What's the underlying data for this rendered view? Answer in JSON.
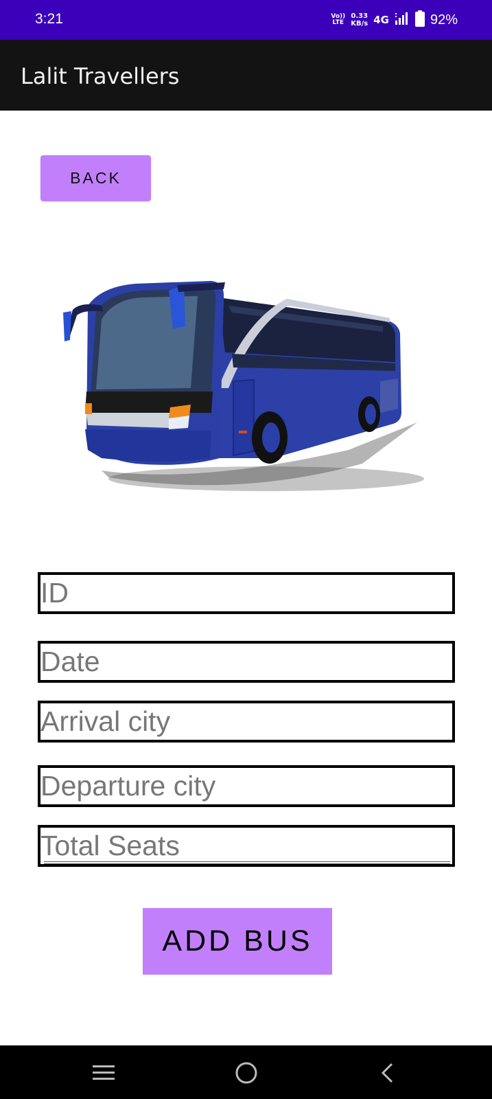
{
  "status_bar": {
    "time": "3:21",
    "volte_top": "Vo))",
    "volte_bottom": "LTE",
    "net_speed_value": "0.33",
    "net_speed_unit": "KB/s",
    "network_type": "4G",
    "battery_percent": "92%"
  },
  "app_bar": {
    "title": "Lalit Travellers"
  },
  "back_button": {
    "label": "BACK"
  },
  "form": {
    "id_placeholder": "ID",
    "date_placeholder": "Date",
    "arrival_city_placeholder": "Arrival city",
    "departure_city_placeholder": "Departure city",
    "total_seats_placeholder": "Total Seats"
  },
  "add_bus_button": {
    "label": "ADD BUS"
  },
  "icons": {
    "nav_recents": "menu-icon",
    "nav_home": "circle-home-icon",
    "nav_back": "chevron-left-icon",
    "battery": "battery-icon",
    "signal": "signal-icon"
  },
  "colors": {
    "status_bar": "#3d00ba",
    "app_bar": "#131313",
    "accent_button": "#c27ffc"
  }
}
